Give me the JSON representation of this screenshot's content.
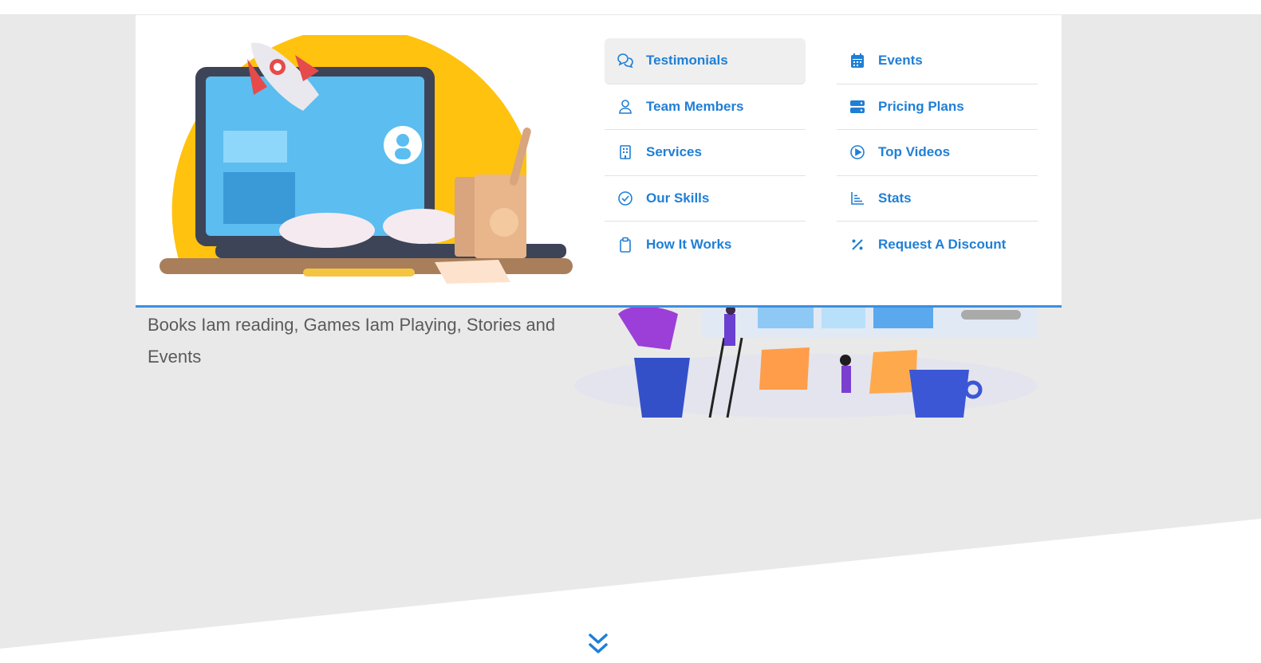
{
  "hero": {
    "tagline_line1": "Books Iam reading, Games Iam Playing, Stories and",
    "tagline_line2": "Events"
  },
  "mega_menu": {
    "columns": [
      {
        "items": [
          {
            "label": "Testimonials",
            "icon": "chat-bubbles-icon",
            "active": true
          },
          {
            "label": "Team Members",
            "icon": "user-icon"
          },
          {
            "label": "Services",
            "icon": "building-icon"
          },
          {
            "label": "Our Skills",
            "icon": "check-circle-icon"
          },
          {
            "label": "How It Works",
            "icon": "clipboard-icon"
          }
        ]
      },
      {
        "items": [
          {
            "label": "Events",
            "icon": "calendar-icon"
          },
          {
            "label": "Pricing Plans",
            "icon": "server-icon"
          },
          {
            "label": "Top Videos",
            "icon": "play-circle-icon"
          },
          {
            "label": "Stats",
            "icon": "bar-chart-icon"
          },
          {
            "label": "Request A Discount",
            "icon": "percent-icon"
          }
        ]
      }
    ]
  },
  "colors": {
    "accent": "#1f7fd6",
    "hero_gray": "#e9e9e9",
    "menu_border": "#3b8fe0",
    "text_gray": "#5a5a5a"
  },
  "scroll_icon": "double-chevron-down-icon"
}
